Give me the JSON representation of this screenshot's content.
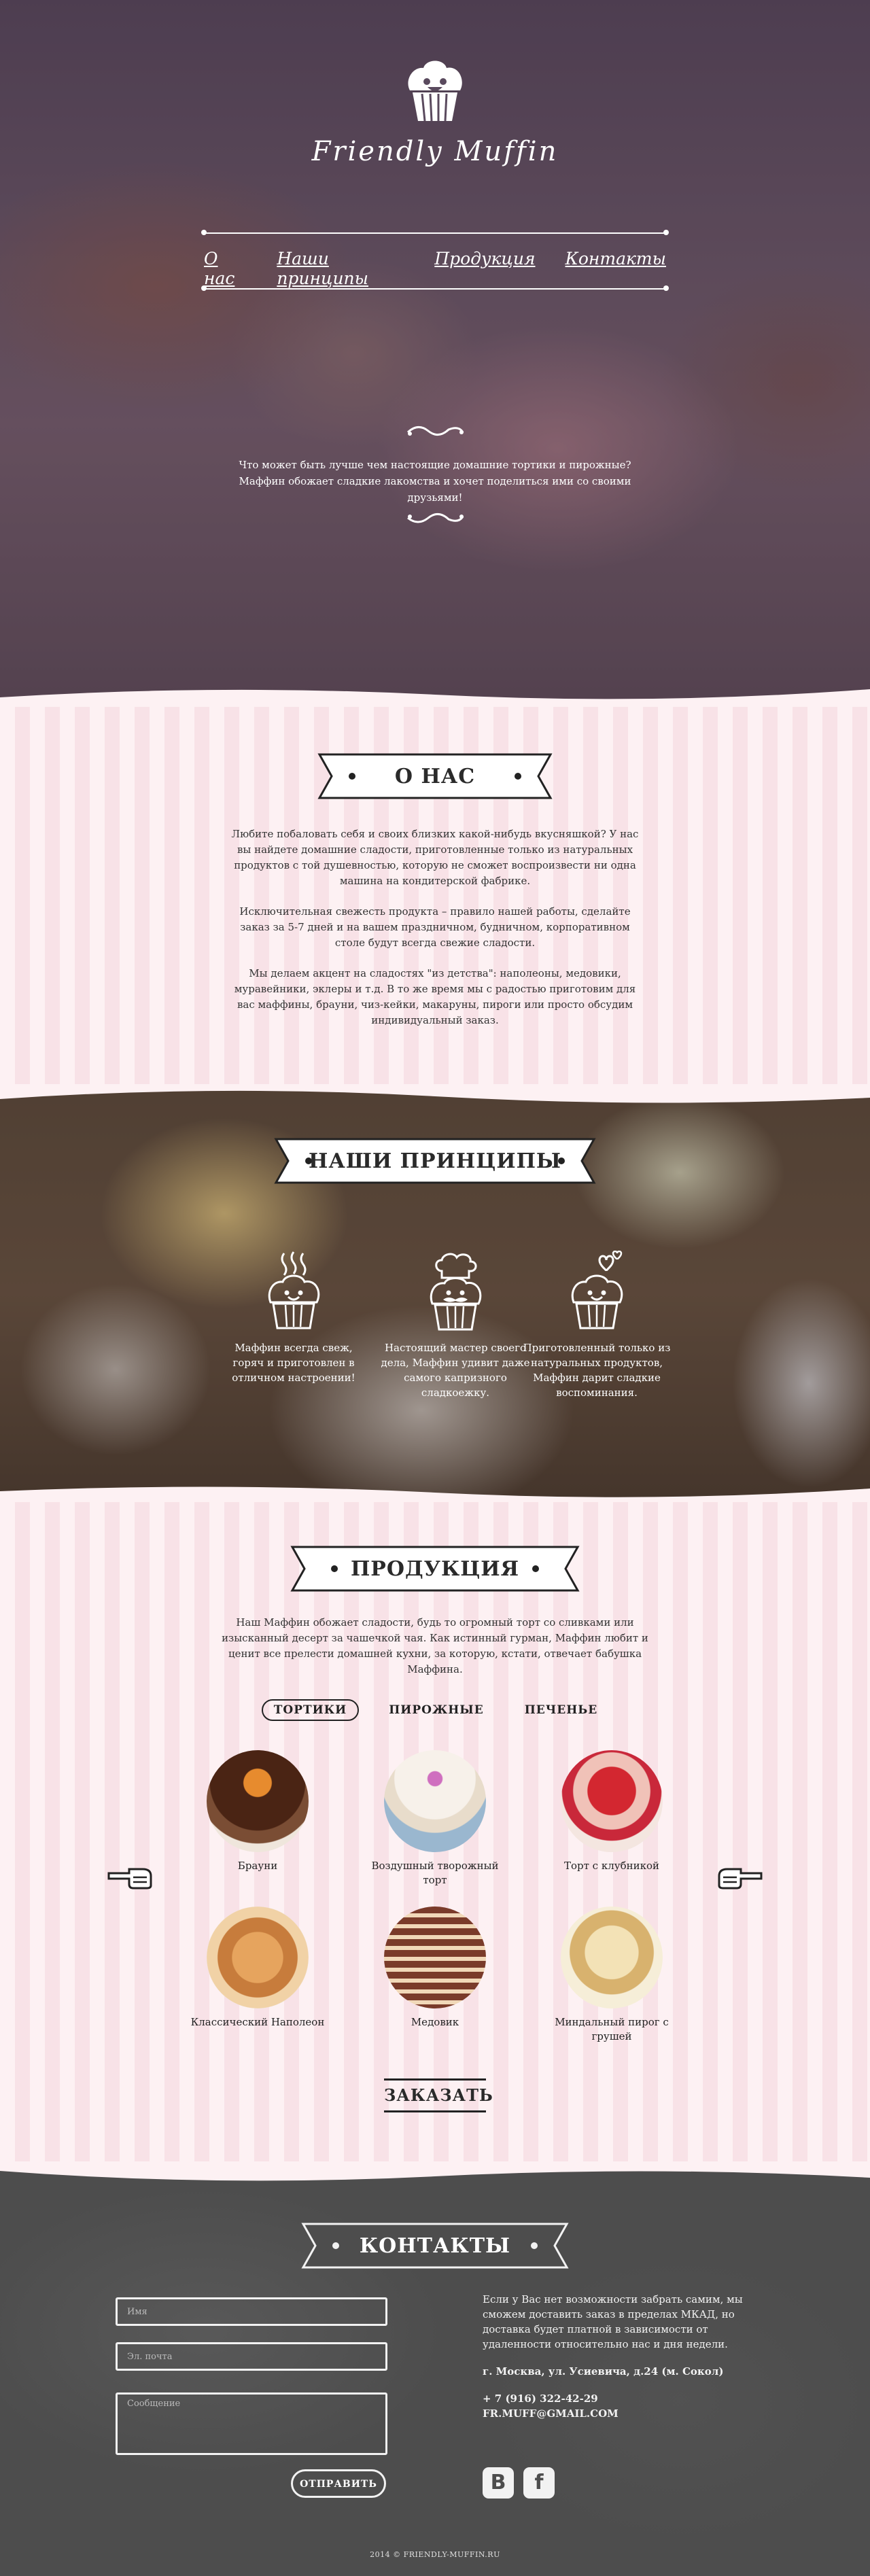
{
  "header": {
    "logo_text": "Friendly Muffin",
    "nav": [
      "О нас",
      "Наши принципы",
      "Продукция",
      "Контакты"
    ],
    "intro": "Что может быть лучше чем настоящие домашние тортики и пирожные? Маффин обожает сладкие лакомства и хочет поделиться ими со своими друзьями!"
  },
  "about": {
    "title": "О НАС",
    "paragraphs": [
      "Любите побаловать себя и своих близких какой-нибудь вкусняшкой? У нас вы найдете домашние сладости, приготовленные только из натуральных продуктов с той душевностью, которую не сможет воспроизвести ни одна машина на кондитерской фабрике.",
      "Исключительная свежесть продукта – правило нашей работы, сделайте заказ за 5-7 дней и на вашем праздничном, будничном, корпоративном столе будут всегда свежие сладости.",
      "Мы делаем акцент на сладостях \"из детства\": наполеоны, медовики, муравейники, эклеры и т.д. В то же время мы с радостью приготовим для вас маффины, брауни, чиз-кейки, макаруны, пироги или просто обсудим индивидуальный заказ."
    ]
  },
  "principles": {
    "title": "НАШИ ПРИНЦИПЫ",
    "items": [
      "Маффин всегда свеж, горяч и приготовлен в отличном настроении!",
      "Настоящий мастер своего дела, Маффин удивит даже самого капризного сладкоежку.",
      "Приготовленный только из натуральных продуктов, Маффин дарит сладкие воспоминания."
    ]
  },
  "products": {
    "title": "ПРОДУКЦИЯ",
    "intro": "Наш Маффин обожает сладости, будь то огромный торт со сливками или изысканный десерт за чашечкой чая. Как истинный гурман, Маффин любит и ценит все прелести домашней кухни, за которую, кстати, отвечает бабушка Маффина.",
    "tabs": [
      "ТОРТИКИ",
      "ПИРОЖНЫЕ",
      "ПЕЧЕНЬЕ"
    ],
    "active_tab": "ТОРТИКИ",
    "items": [
      {
        "name": "Брауни",
        "color": "#6b3a22"
      },
      {
        "name": "Воздушный творожный торт",
        "color": "#f1ece6"
      },
      {
        "name": "Торт с клубникой",
        "color": "#c8323a"
      },
      {
        "name": "Классический Наполеон",
        "color": "#e0a062"
      },
      {
        "name": "Медовик",
        "color": "#b9795a"
      },
      {
        "name": "Миндальный пирог с грушей",
        "color": "#ecd8a6"
      }
    ],
    "order_label": "ЗАКАЗАТЬ"
  },
  "contacts": {
    "title": "КОНТАКТЫ",
    "name_placeholder": "Имя",
    "email_placeholder": "Эл. почта",
    "message_placeholder": "Сообщение",
    "send_label": "ОТПРАВИТЬ",
    "delivery_text": "Если у Вас нет возможности забрать самим, мы сможем доставить заказ в пределах МКАД, но доставка будет платной в зависимости от удаленности относительно нас и дня недели.",
    "address": "г. Москва, ул. Усиевича, д.24 (м. Сокол)",
    "phone": "+ 7 (916) 322-42-29",
    "email": "FR.MUFF@GMAIL.COM",
    "social": [
      "В",
      "f"
    ]
  },
  "footer": {
    "copyright": "2014 © FRIENDLY-MUFFIN.RU"
  }
}
